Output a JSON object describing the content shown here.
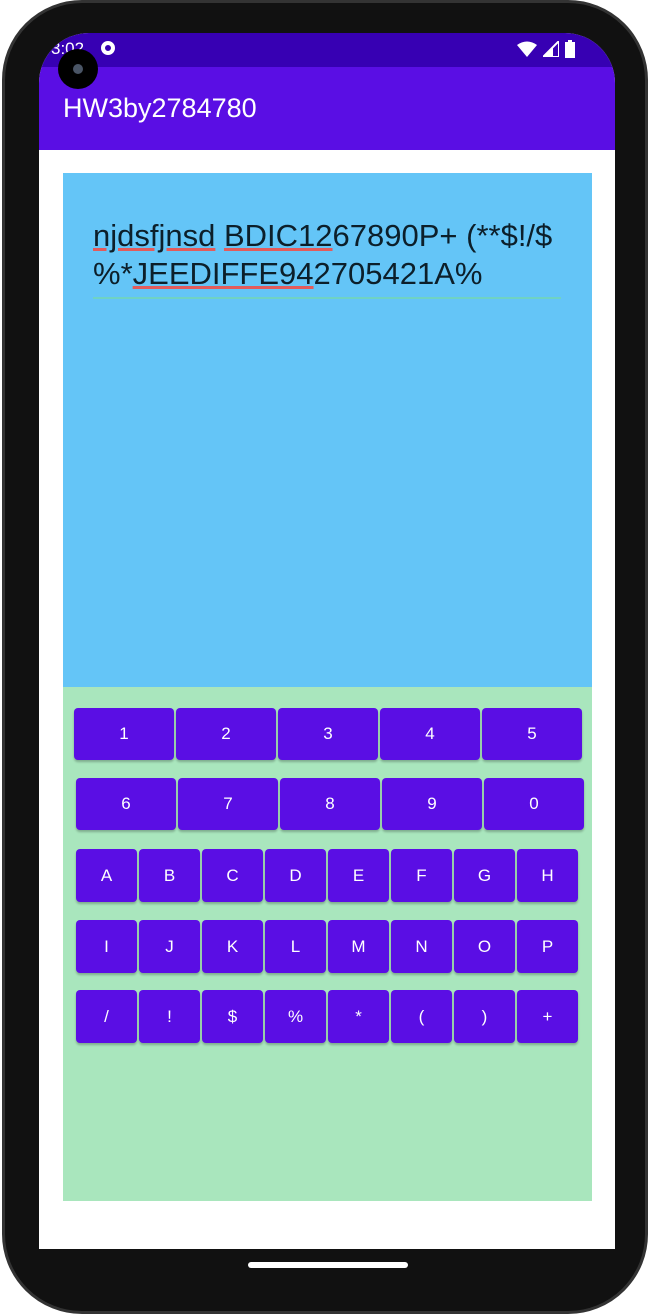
{
  "status_bar": {
    "time": "3:02",
    "icons": [
      "media-icon",
      "wifi-icon",
      "signal-icon",
      "battery-icon"
    ]
  },
  "app_bar": {
    "title": "HW3by2784780"
  },
  "input": {
    "parts": [
      {
        "t": "njdsfjnsd",
        "u": true
      },
      {
        "t": " ",
        "u": false
      },
      {
        "t": "BDIC12",
        "u": true
      },
      {
        "t": "67890P+ (**$!/$ %*",
        "u": false
      },
      {
        "t": "JEEDIFFE94",
        "u": true
      },
      {
        "t": "2705421A%",
        "u": false
      }
    ]
  },
  "keyboard": {
    "rows": [
      [
        "1",
        "2",
        "3",
        "4",
        "5"
      ],
      [
        "6",
        "7",
        "8",
        "9",
        "0"
      ],
      [
        "A",
        "B",
        "C",
        "D",
        "E",
        "F",
        "G",
        "H"
      ],
      [
        "I",
        "J",
        "K",
        "L",
        "M",
        "N",
        "O",
        "P"
      ],
      [
        "/",
        "!",
        "$",
        "%",
        "*",
        "(",
        ")",
        "+"
      ]
    ]
  },
  "colors": {
    "primary": "#5a0ee4",
    "status": "#3700b3",
    "display": "#64c5f7",
    "keypad": "#a9e6bd"
  }
}
